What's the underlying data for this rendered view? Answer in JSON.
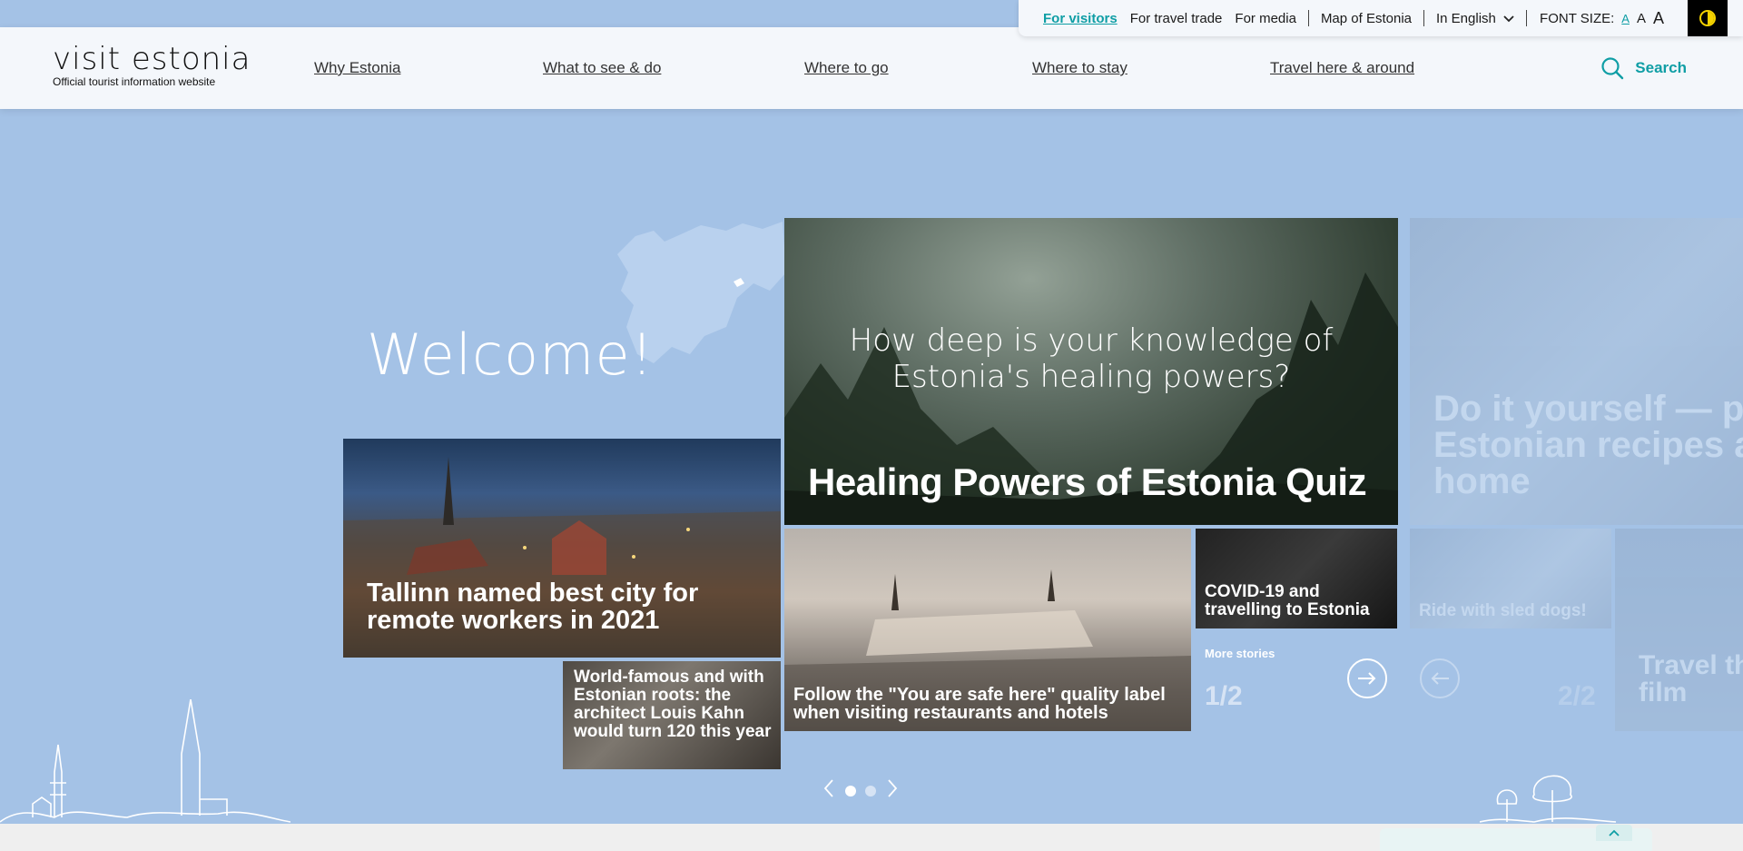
{
  "utility": {
    "for_visitors": "For visitors",
    "for_travel_trade": "For travel trade",
    "for_media": "For media",
    "map": "Map of Estonia",
    "language": "In English",
    "font_size_label": "FONT SIZE:",
    "fs_small": "A",
    "fs_mid": "A",
    "fs_big": "A"
  },
  "header": {
    "brand": "visit estonia",
    "tagline": "Official tourist information website",
    "nav": [
      "Why Estonia",
      "What to see & do",
      "Where to go",
      "Where to stay",
      "Travel here & around"
    ],
    "search": "Search"
  },
  "hero": {
    "welcome": "Welcome!",
    "quiz_question": "How deep is your knowledge of Estonia's healing powers?",
    "quiz_title": "Healing Powers of Estonia Quiz",
    "tallinn": "Tallinn named best city for remote workers in 2021",
    "kahn": "World-famous and with Estonian roots: the architect Louis Kahn would turn 120 this year",
    "safe": "Follow the \"You are safe here\" quality label when visiting restaurants and hotels",
    "covid": "COVID-19 and travelling to Estonia",
    "more_stories": "More stories",
    "counter": "1/2",
    "counter_next": "2/2",
    "ghost_recipes": "Do it yourself — po Estonian recipes at home",
    "ghost_sled": "Ride with sled dogs!",
    "ghost_film": "Travel th film"
  },
  "pager": {
    "pages": 2,
    "active": 1
  }
}
